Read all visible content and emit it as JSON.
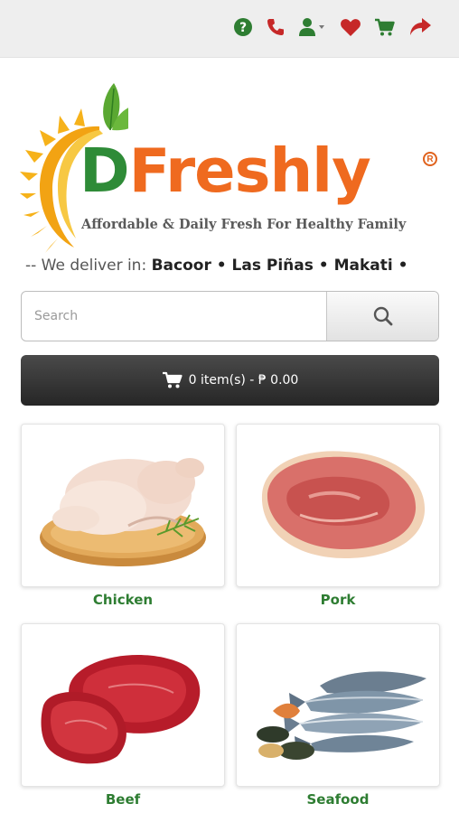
{
  "header": {
    "icons": [
      "help-icon",
      "phone-icon",
      "user-icon",
      "heart-icon",
      "cart-icon",
      "share-icon"
    ],
    "icon_color": "#2e7d32",
    "accent_color": "#c62828"
  },
  "brand": {
    "logo_first": "D",
    "logo_rest": "Freshly",
    "registered": "R",
    "tagline": "Affordable & Daily Fresh For Healthy Family",
    "green": "#2e8b37",
    "orange": "#ef6a1f"
  },
  "delivery": {
    "prefix": "-- We deliver in:",
    "areas": "Bacoor • Las Piñas • Makati •"
  },
  "search": {
    "placeholder": "Search"
  },
  "cart": {
    "summary": "0 item(s) - ₱ 0.00"
  },
  "categories": [
    {
      "label": "Chicken"
    },
    {
      "label": "Pork"
    },
    {
      "label": "Beef"
    },
    {
      "label": "Seafood"
    }
  ]
}
